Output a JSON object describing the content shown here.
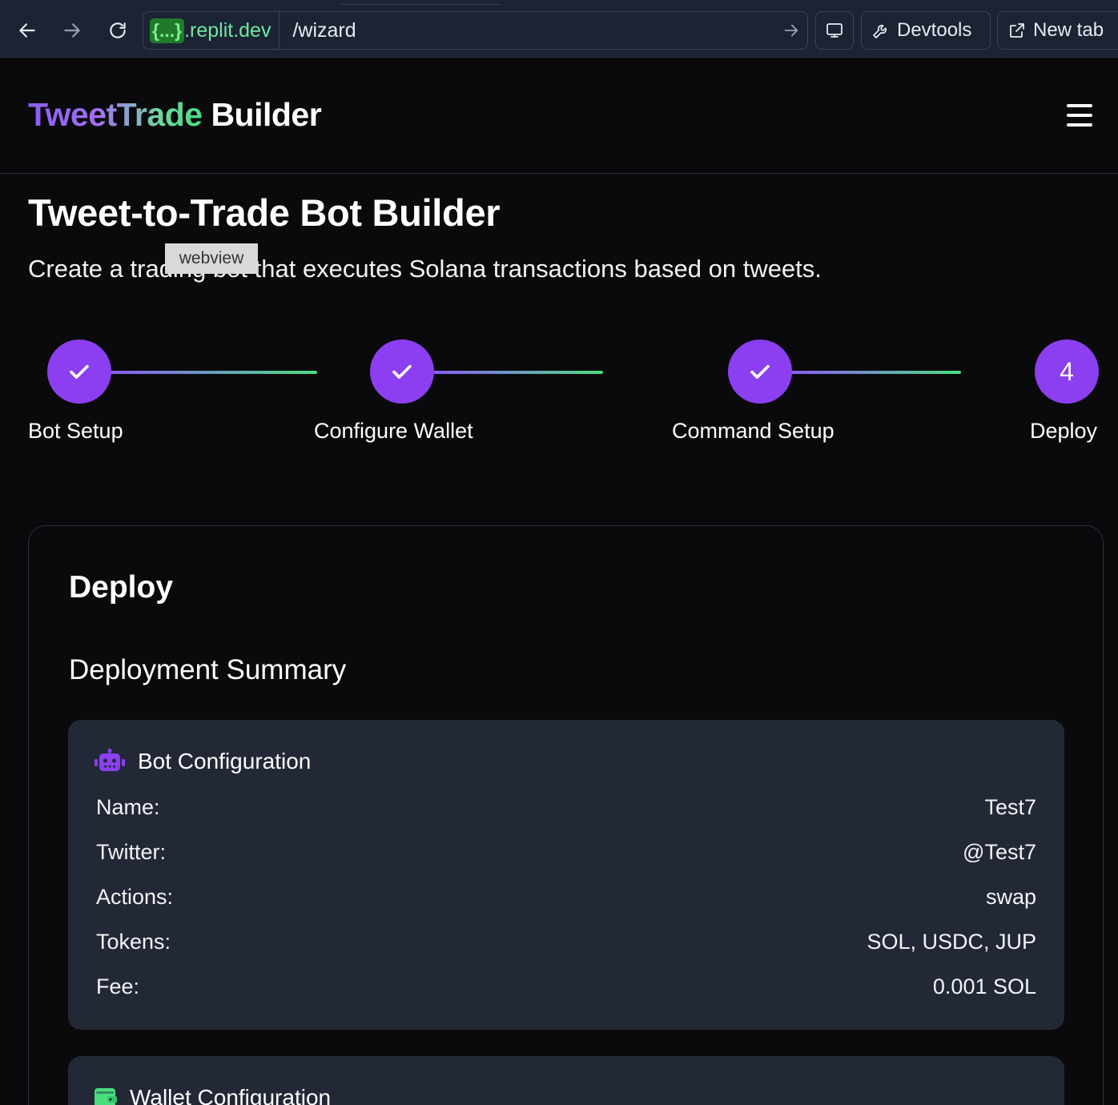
{
  "browser": {
    "url_host_badge": "{...}",
    "url_host": ".replit.dev",
    "url_path": "/wizard",
    "devtools_label": "Devtools",
    "new_tab_label": "New tab"
  },
  "header": {
    "logo_gradient": "TweetTrade",
    "logo_plain": "Builder"
  },
  "page": {
    "title": "Tweet-to-Trade Bot Builder",
    "subtitle": "Create a trading bot that executes Solana transactions based on tweets.",
    "tooltip": "webview"
  },
  "steps": [
    {
      "label": "Bot Setup",
      "status": "complete",
      "marker": ""
    },
    {
      "label": "Configure Wallet",
      "status": "complete",
      "marker": ""
    },
    {
      "label": "Command Setup",
      "status": "complete",
      "marker": ""
    },
    {
      "label": "Deploy",
      "status": "current",
      "marker": "4"
    }
  ],
  "deploy": {
    "title": "Deploy",
    "summary_title": "Deployment Summary",
    "bot_config": {
      "heading": "Bot Configuration",
      "icon": "robot-icon",
      "rows": [
        {
          "label": "Name:",
          "value": "Test7"
        },
        {
          "label": "Twitter:",
          "value": "@Test7"
        },
        {
          "label": "Actions:",
          "value": "swap"
        },
        {
          "label": "Tokens:",
          "value": "SOL, USDC, JUP"
        },
        {
          "label": "Fee:",
          "value": "0.001 SOL"
        }
      ]
    },
    "wallet_config": {
      "heading": "Wallet Configuration",
      "icon": "wallet-icon"
    }
  },
  "colors": {
    "accent_purple": "#8b3ff0",
    "accent_green": "#4ade80",
    "panel_bg": "#222836",
    "page_bg": "#0a0a0c"
  }
}
